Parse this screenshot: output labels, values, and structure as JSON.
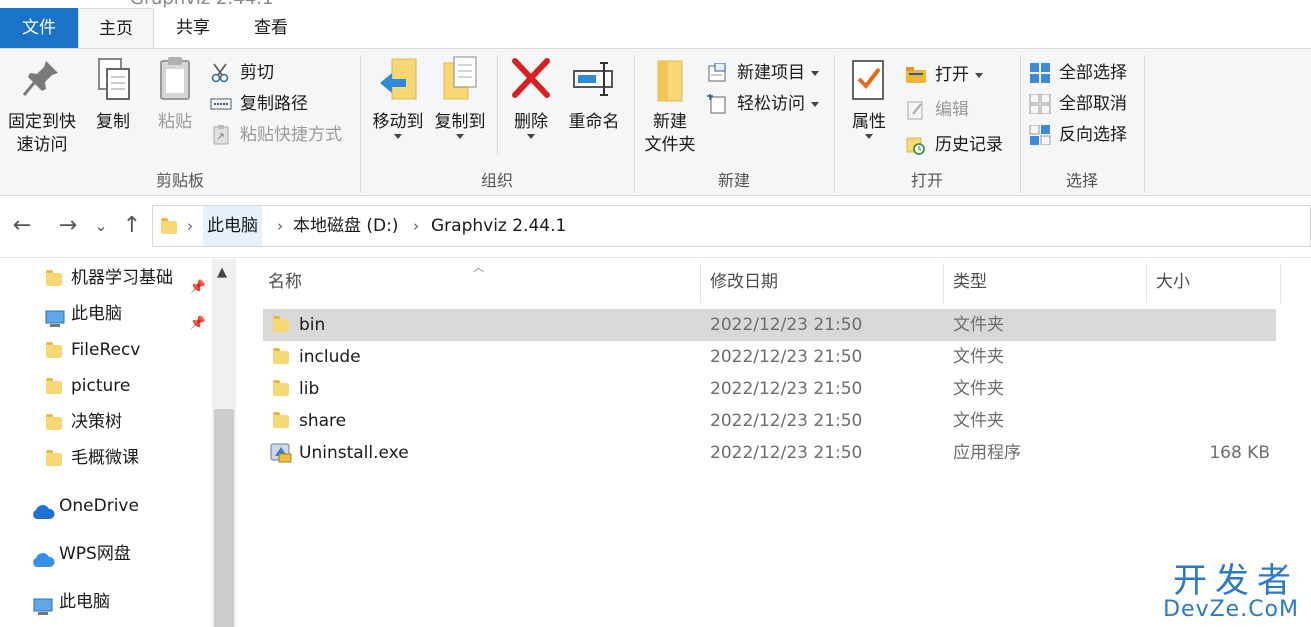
{
  "window": {
    "title": "Graphviz 2.44.1"
  },
  "tabs": {
    "file": "文件",
    "home": "主页",
    "share": "共享",
    "view": "查看"
  },
  "ribbon": {
    "clipboard": {
      "label": "剪贴板",
      "pin_label_1": "固定到快",
      "pin_label_2": "速访问",
      "copy": "复制",
      "paste": "粘贴",
      "cut": "剪切",
      "copy_path": "复制路径",
      "paste_shortcut": "粘贴快捷方式"
    },
    "organize": {
      "label": "组织",
      "move_to": "移动到",
      "copy_to": "复制到",
      "delete": "删除",
      "rename": "重命名"
    },
    "new": {
      "label": "新建",
      "new_folder_1": "新建",
      "new_folder_2": "文件夹",
      "new_item": "新建项目",
      "easy_access": "轻松访问"
    },
    "open": {
      "label": "打开",
      "properties": "属性",
      "open": "打开",
      "edit": "编辑",
      "history": "历史记录"
    },
    "select": {
      "label": "选择",
      "select_all": "全部选择",
      "select_none": "全部取消",
      "invert": "反向选择"
    }
  },
  "nav": {
    "back": "←",
    "forward": "→",
    "recent": "⌄",
    "up": "↑",
    "crumbs": [
      "此电脑",
      "本地磁盘 (D:)",
      "Graphviz 2.44.1"
    ]
  },
  "navpane": {
    "items": [
      {
        "label": "机器学习基础",
        "pinned": true
      },
      {
        "label": "此电脑",
        "pinned": true
      },
      {
        "label": "FileRecv",
        "pinned": false
      },
      {
        "label": "picture",
        "pinned": false
      },
      {
        "label": "决策树",
        "pinned": false
      },
      {
        "label": "毛概微课",
        "pinned": false
      }
    ],
    "onedrive": "OneDrive",
    "wps": "WPS网盘",
    "thispc": "此电脑"
  },
  "filelist": {
    "columns": {
      "name": "名称",
      "date": "修改日期",
      "type": "类型",
      "size": "大小"
    },
    "rows": [
      {
        "name": "bin",
        "date": "2022/12/23 21:50",
        "type": "文件夹",
        "size": "",
        "icon": "folder-icon",
        "selected": true
      },
      {
        "name": "include",
        "date": "2022/12/23 21:50",
        "type": "文件夹",
        "size": "",
        "icon": "folder-icon",
        "selected": false
      },
      {
        "name": "lib",
        "date": "2022/12/23 21:50",
        "type": "文件夹",
        "size": "",
        "icon": "folder-icon",
        "selected": false
      },
      {
        "name": "share",
        "date": "2022/12/23 21:50",
        "type": "文件夹",
        "size": "",
        "icon": "folder-icon",
        "selected": false
      },
      {
        "name": "Uninstall.exe",
        "date": "2022/12/23 21:50",
        "type": "应用程序",
        "size": "168 KB",
        "icon": "installer-icon",
        "selected": false
      }
    ]
  },
  "watermark": {
    "cn": "开发者",
    "en": "DevZe.CoM"
  },
  "colors": {
    "accent": "#1a73c8",
    "selection": "#d9d9d9",
    "ribbon_bg": "#f5f6f7"
  }
}
